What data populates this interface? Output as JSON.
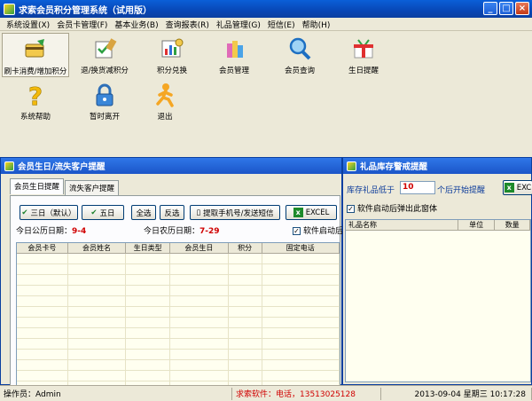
{
  "window": {
    "title": "求索会员积分管理系统（试用版）",
    "buttons": [
      "_",
      "□",
      "×"
    ]
  },
  "menu": [
    "系统设置(X)",
    "会员卡管理(F)",
    "基本业务(B)",
    "查询报表(R)",
    "礼品管理(G)",
    "短信(E)",
    "帮助(H)"
  ],
  "toolbar": [
    {
      "label": "刷卡消费/增加积分",
      "icon": "card-swipe-icon"
    },
    {
      "label": "退/换货减积分",
      "icon": "return-goods-icon"
    },
    {
      "label": "积分兑换",
      "icon": "points-exchange-icon"
    },
    {
      "label": "会员管理",
      "icon": "member-management-icon"
    },
    {
      "label": "会员查询",
      "icon": "magnifier-icon"
    },
    {
      "label": "生日提醒",
      "icon": "birthday-gift-icon"
    },
    {
      "label": "系统帮助",
      "icon": "question-mark-icon"
    },
    {
      "label": "暂时离开",
      "icon": "lock-icon"
    },
    {
      "label": "退出",
      "icon": "runner-exit-icon"
    }
  ],
  "birthday_panel": {
    "title": "会员生日/流失客户提醒",
    "tabs": [
      "会员生日提醒",
      "流失客户提醒"
    ],
    "buttons": {
      "three_days": "三日（默认）",
      "five_days": "五日",
      "select_all": "全选",
      "invert": "反选",
      "sms": "提取手机号/发送短信",
      "excel": "EXCEL"
    },
    "today_solar_label": "今日公历日期：",
    "today_solar": "9-4",
    "today_lunar_label": "今日农历日期：",
    "today_lunar": "7-29",
    "startup_check": "软件启动后弹",
    "columns": [
      "会员卡号",
      "会员姓名",
      "生日类型",
      "会员生日",
      "积分",
      "固定电话"
    ]
  },
  "gift_panel": {
    "title": "礼品库存警戒提醒",
    "threshold_prefix": "库存礼品低于",
    "threshold_value": "10",
    "threshold_suffix": "个后开始提醒",
    "excel": "EXC",
    "popup_check": "软件启动后弹出此窗体",
    "columns": [
      "礼品名称",
      "单位",
      "数量"
    ]
  },
  "status": {
    "operator": "操作员：Admin",
    "vendor": "求索软件：电话，13513025128",
    "datetime": "2013-09-04 星期三  10:17:28"
  },
  "colors": {
    "title_bar": "#0847b6",
    "red_text": "#d00000",
    "panel_bg": "#ece9d8"
  }
}
